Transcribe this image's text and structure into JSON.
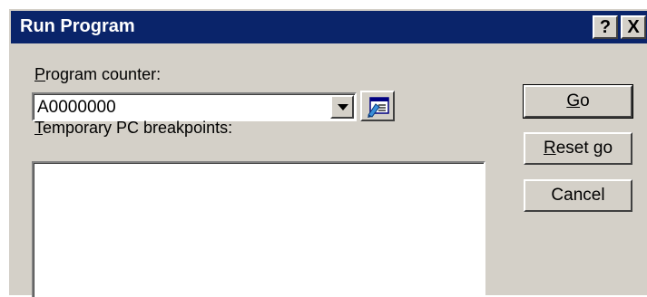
{
  "window": {
    "title": "Run Program",
    "help_glyph": "?",
    "close_glyph": "X"
  },
  "program_counter": {
    "label_mnemonic": "P",
    "label_rest": "rogram counter:",
    "value": "A0000000"
  },
  "breakpoints": {
    "label_mnemonic": "T",
    "label_rest": "emporary PC breakpoints:"
  },
  "buttons": {
    "go_mnemonic": "G",
    "go_rest": "o",
    "reset_mnemonic": "R",
    "reset_rest": "eset go",
    "cancel": "Cancel"
  },
  "icons": {
    "dropdown": "chevron-down-icon",
    "browse": "card-edit-icon"
  },
  "colors": {
    "title_bar": "#0a246a",
    "window_face": "#d4d0c8"
  }
}
